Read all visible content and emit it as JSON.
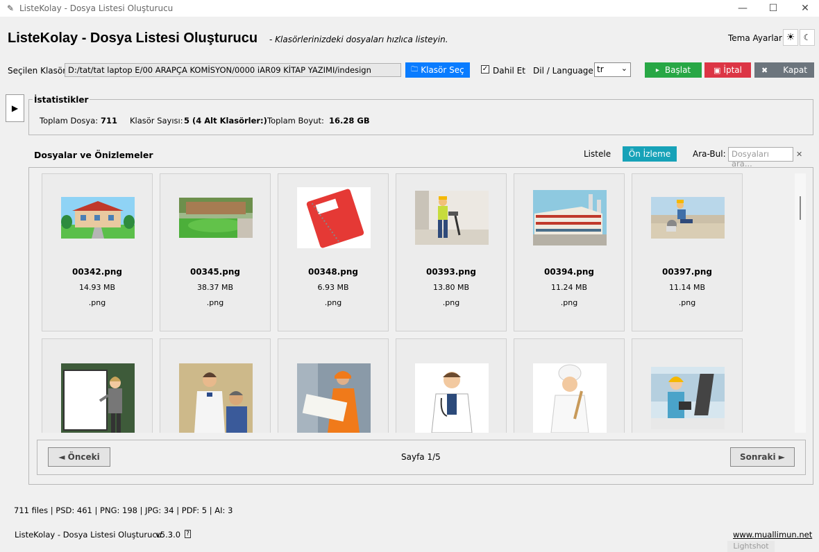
{
  "window": {
    "title": "ListeKolay - Dosya Listesi Oluşturucu",
    "minimize": "—",
    "maximize": "☐",
    "close": "✕"
  },
  "header": {
    "title": "ListeKolay - Dosya Listesi Oluşturucu",
    "subtitle": "- Klasörlerinizdeki dosyaları hızlıca listeyin.",
    "theme_label": "Tema Ayarları",
    "theme_icon": "☀",
    "moon_icon": "☾"
  },
  "folder": {
    "label": "Seçilen Klasör:",
    "path": "D:/tat/tat laptop E/00 ARAPÇA KOMİSYON/0000 iAR09 KİTAP YAZIMI/indesign",
    "select_button": "Klasör Seç",
    "include_label": "Dahil Et",
    "include_checked": "✓",
    "lang_label": "Dil / Language:",
    "lang_value": "tr"
  },
  "actions": {
    "start": "Başlat",
    "cancel": "İptal",
    "close": "Kapat"
  },
  "side_toggle": "▶",
  "stats": {
    "title": "İstatistikler",
    "total_files_label": "Toplam Dosya:",
    "total_files": "711",
    "folder_count_label": "Klasör Sayısı:",
    "folder_count": "5 (4 Alt Klasörler:)",
    "total_size_label": "Toplam Boyut:",
    "total_size": "16.28 GB"
  },
  "files": {
    "title": "Dosyalar ve Önizlemeler",
    "view_list": "Listele",
    "view_preview": "Ön İzleme",
    "search_label": "Ara-Bul:",
    "search_placeholder": "Dosyaları ara...",
    "clear": "✕"
  },
  "cards": [
    {
      "name": "00342.png",
      "size": "14.93 MB",
      "ext": ".png",
      "thumb": "house-image"
    },
    {
      "name": "00345.png",
      "size": "38.37 MB",
      "ext": ".png",
      "thumb": "garden-image"
    },
    {
      "name": "00348.png",
      "size": "6.93 MB",
      "ext": ".png",
      "thumb": "notebook-image"
    },
    {
      "name": "00393.png",
      "size": "13.80 MB",
      "ext": ".png",
      "thumb": "worker-drill-image"
    },
    {
      "name": "00394.png",
      "size": "11.24 MB",
      "ext": ".png",
      "thumb": "factory-image"
    },
    {
      "name": "00397.png",
      "size": "11.14 MB",
      "ext": ".png",
      "thumb": "worker-grinder-image"
    },
    {
      "name": "",
      "size": "",
      "ext": "",
      "thumb": "presenter-image"
    },
    {
      "name": "",
      "size": "",
      "ext": "",
      "thumb": "doctor-patient-image"
    },
    {
      "name": "",
      "size": "",
      "ext": "",
      "thumb": "engineer-image"
    },
    {
      "name": "",
      "size": "",
      "ext": "",
      "thumb": "doctor-image"
    },
    {
      "name": "",
      "size": "",
      "ext": "",
      "thumb": "chef-image"
    },
    {
      "name": "",
      "size": "",
      "ext": "",
      "thumb": "engineer-tablet-image"
    }
  ],
  "pager": {
    "prev": "◄ Önceki",
    "page": "Sayfa 1/5",
    "next": "Sonraki ►"
  },
  "footer": {
    "file_counts": "711 files | PSD: 461 | PNG: 198 | JPG: 34 | PDF: 5 | AI: 3",
    "app_name": "ListeKolay - Dosya Listesi Oluşturucu",
    "version": "v5.3.0",
    "help": "?",
    "link": "www.muallimun.net",
    "lightshot": "Lightshot"
  }
}
